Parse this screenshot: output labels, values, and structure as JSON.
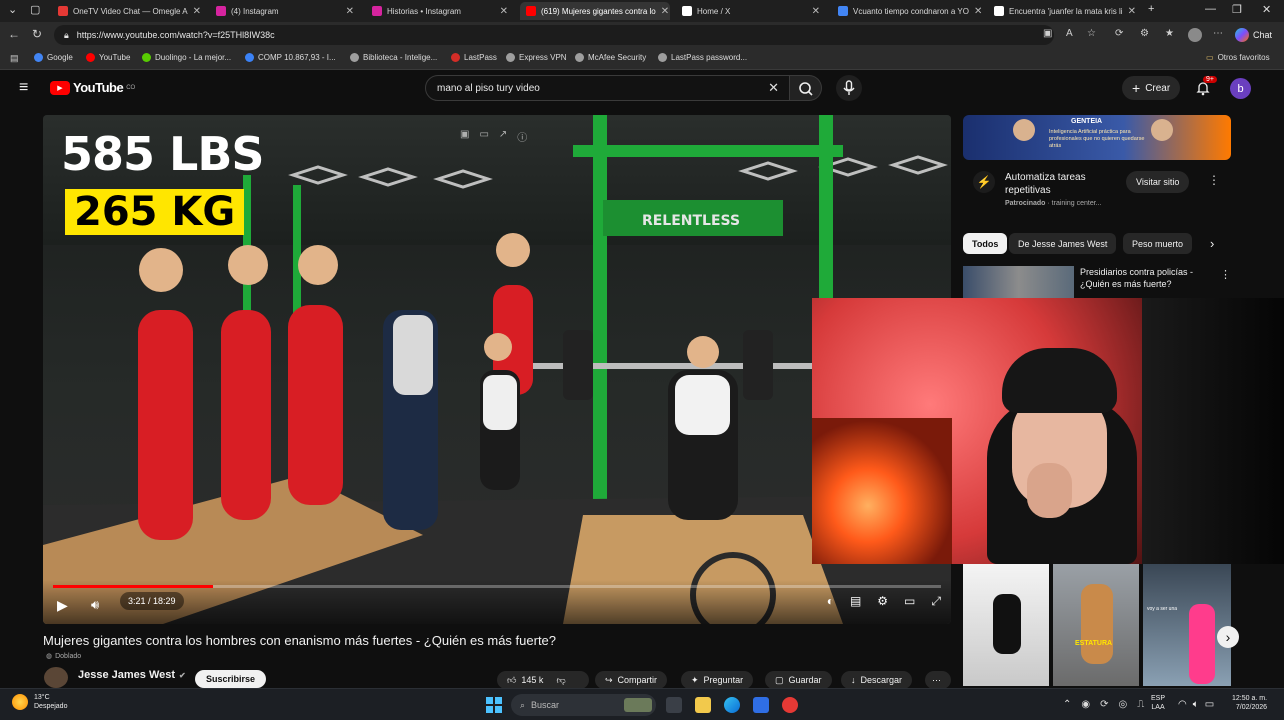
{
  "browser": {
    "tabs": [
      {
        "title": "OneTV Video Chat — Omegle A",
        "color": "#e53935"
      },
      {
        "title": "(4) Instagram",
        "color": "#d6249f"
      },
      {
        "title": "Historias • Instagram",
        "color": "#d6249f"
      },
      {
        "title": "(619) Mujeres gigantes contra lo",
        "color": "#ff0000"
      },
      {
        "title": "Home / X",
        "color": "#ffffff"
      },
      {
        "title": "Vcuanto tiempo condnaron a YO",
        "color": "#4285f4"
      },
      {
        "title": "Encuentra 'juanfer la mata kris li",
        "color": "#ffffff"
      }
    ],
    "url": "https://www.youtube.com/watch?v=f25THl8IW38c",
    "chat_label": "Chat",
    "bookmarks": [
      {
        "label": "Google",
        "color": "#4285f4"
      },
      {
        "label": "YouTube",
        "color": "#ff0000"
      },
      {
        "label": "Duolingo - La mejor...",
        "color": "#58cc02"
      },
      {
        "label": "COMP 10.867,93 - I...",
        "color": "#3b82f6"
      },
      {
        "label": "Biblioteca - Intelige...",
        "color": "#9e9e9e"
      },
      {
        "label": "LastPass",
        "color": "#d32d27"
      },
      {
        "label": "Express VPN",
        "color": "#9e9e9e"
      },
      {
        "label": "McAfee Security",
        "color": "#9e9e9e"
      },
      {
        "label": "LastPass password...",
        "color": "#9e9e9e"
      }
    ],
    "other_favorites": "Otros favoritos"
  },
  "youtube": {
    "logo_text": "YouTube",
    "logo_country": "CO",
    "search_value": "mano al piso tury video",
    "create_label": "Crear",
    "notif_count": "9+",
    "avatar_letter": "b"
  },
  "player": {
    "overlay_line1": "585 LBS",
    "overlay_line2": "265 KG",
    "sign_text": "RELENTLESS",
    "time_current": "3:21",
    "time_total": "18:29",
    "progress_fraction": 0.18,
    "time_display": "3:21 / 18:29"
  },
  "video": {
    "title": "Mujeres gigantes contra los hombres con enanismo más fuertes - ¿Quién es más fuerte?",
    "dubbed_label": "Doblado",
    "channel": "Jesse James West",
    "subscribe_label": "Suscribirse",
    "likes": "145 k",
    "share": "Compartir",
    "ask": "Preguntar",
    "save": "Guardar",
    "download": "Descargar"
  },
  "ad": {
    "brand": "GENTEIA",
    "headline": "Inteligencia Artificial práctica para profesionales que no quieren quedarse atrás",
    "title": "Automatiza tareas repetitivas",
    "sponsored": "Patrocinado",
    "domain": "· training center...",
    "cta": "Visitar sitio"
  },
  "chips": [
    "Todos",
    "De Jesse James West",
    "Peso muerto"
  ],
  "related": {
    "title": "Presidiarios contra policías - ¿Quién es más fuerte?",
    "short_text": "ESTATURA",
    "short_text2": "voy a ser una"
  },
  "taskbar": {
    "temp": "13°C",
    "weather": "Despejado",
    "search": "Buscar",
    "lang1": "ESP",
    "lang2": "LAA",
    "time": "12:50 a. m.",
    "date": "7/02/2026"
  }
}
